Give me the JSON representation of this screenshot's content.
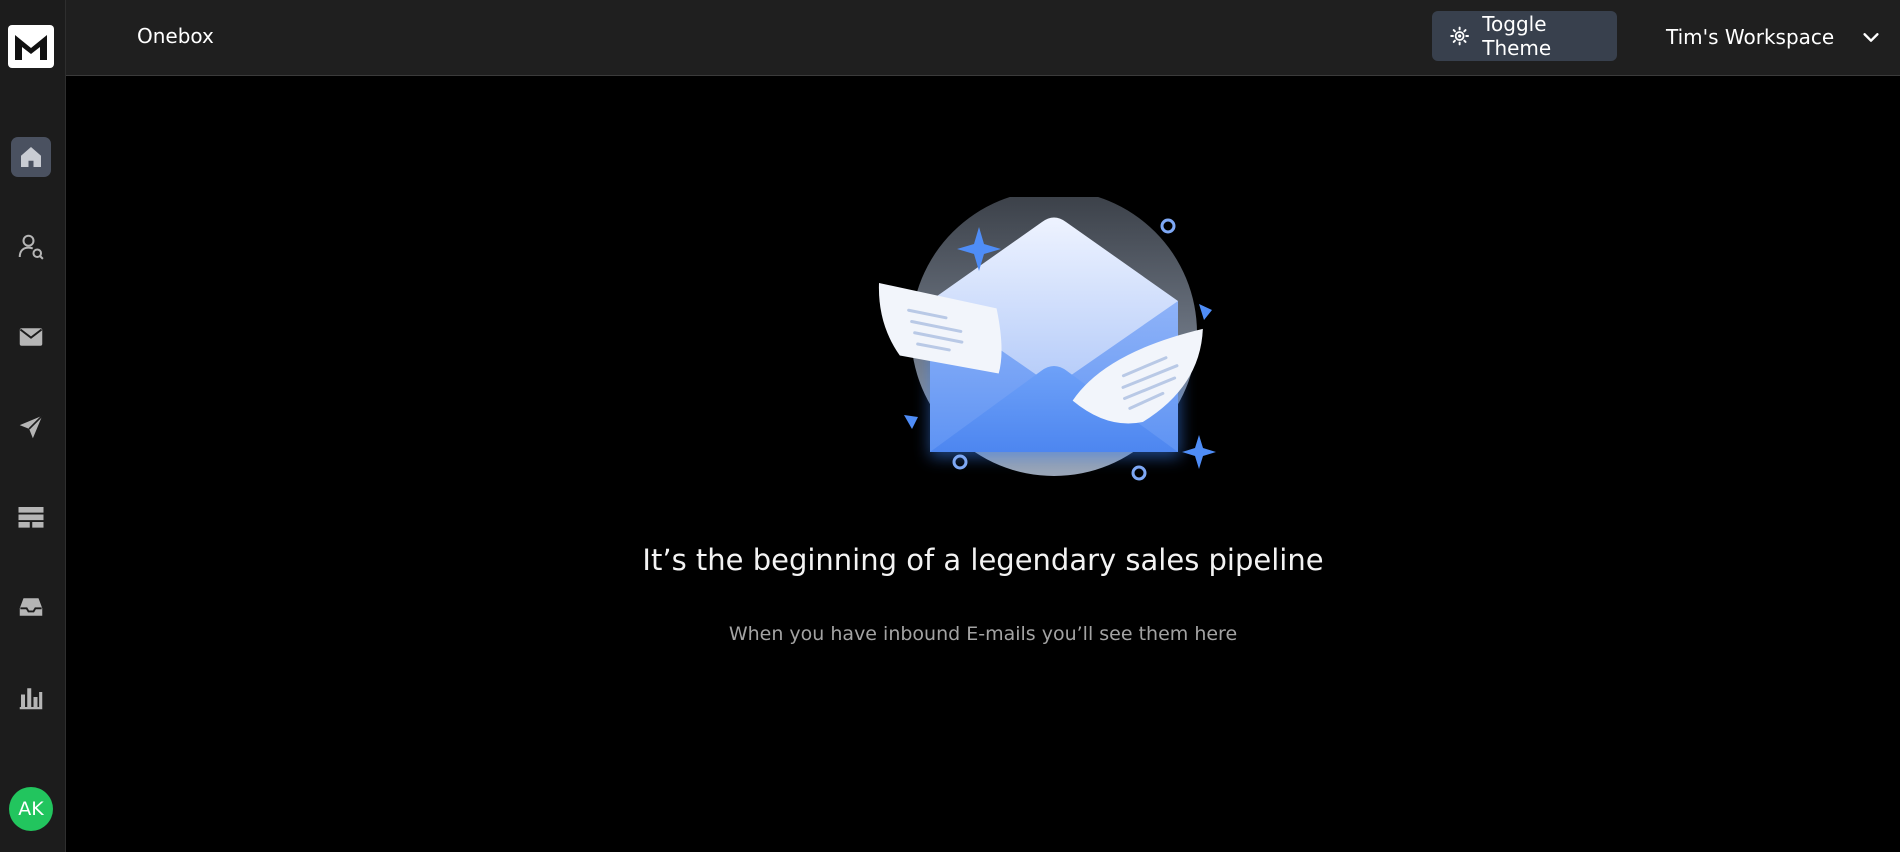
{
  "app": {
    "logo_letter": "M",
    "accent_color": "#3b82f6",
    "avatar_color": "#22c55e"
  },
  "header": {
    "title": "Onebox",
    "toggle_theme_label": "Toggle Theme",
    "toggle_theme_icon": "sun-icon",
    "workspace_name": "Tim's Workspace",
    "workspace_dropdown_icon": "chevron-down-icon"
  },
  "sidebar": {
    "items": [
      {
        "name": "home",
        "icon": "home-icon",
        "active": true
      },
      {
        "name": "lead-search",
        "icon": "user-search-icon",
        "active": false
      },
      {
        "name": "email-accounts",
        "icon": "mail-icon",
        "active": false
      },
      {
        "name": "campaigns",
        "icon": "send-icon",
        "active": false
      },
      {
        "name": "lists",
        "icon": "table-icon",
        "active": false
      },
      {
        "name": "onebox",
        "icon": "inbox-icon",
        "active": false
      },
      {
        "name": "analytics",
        "icon": "bar-chart-icon",
        "active": false
      }
    ],
    "avatar_initials": "AK"
  },
  "empty_state": {
    "illustration": "open-envelope-illustration",
    "headline": "It’s the beginning of a legendary sales pipeline",
    "subtext": "When you have inbound E-mails you’ll see them here"
  }
}
